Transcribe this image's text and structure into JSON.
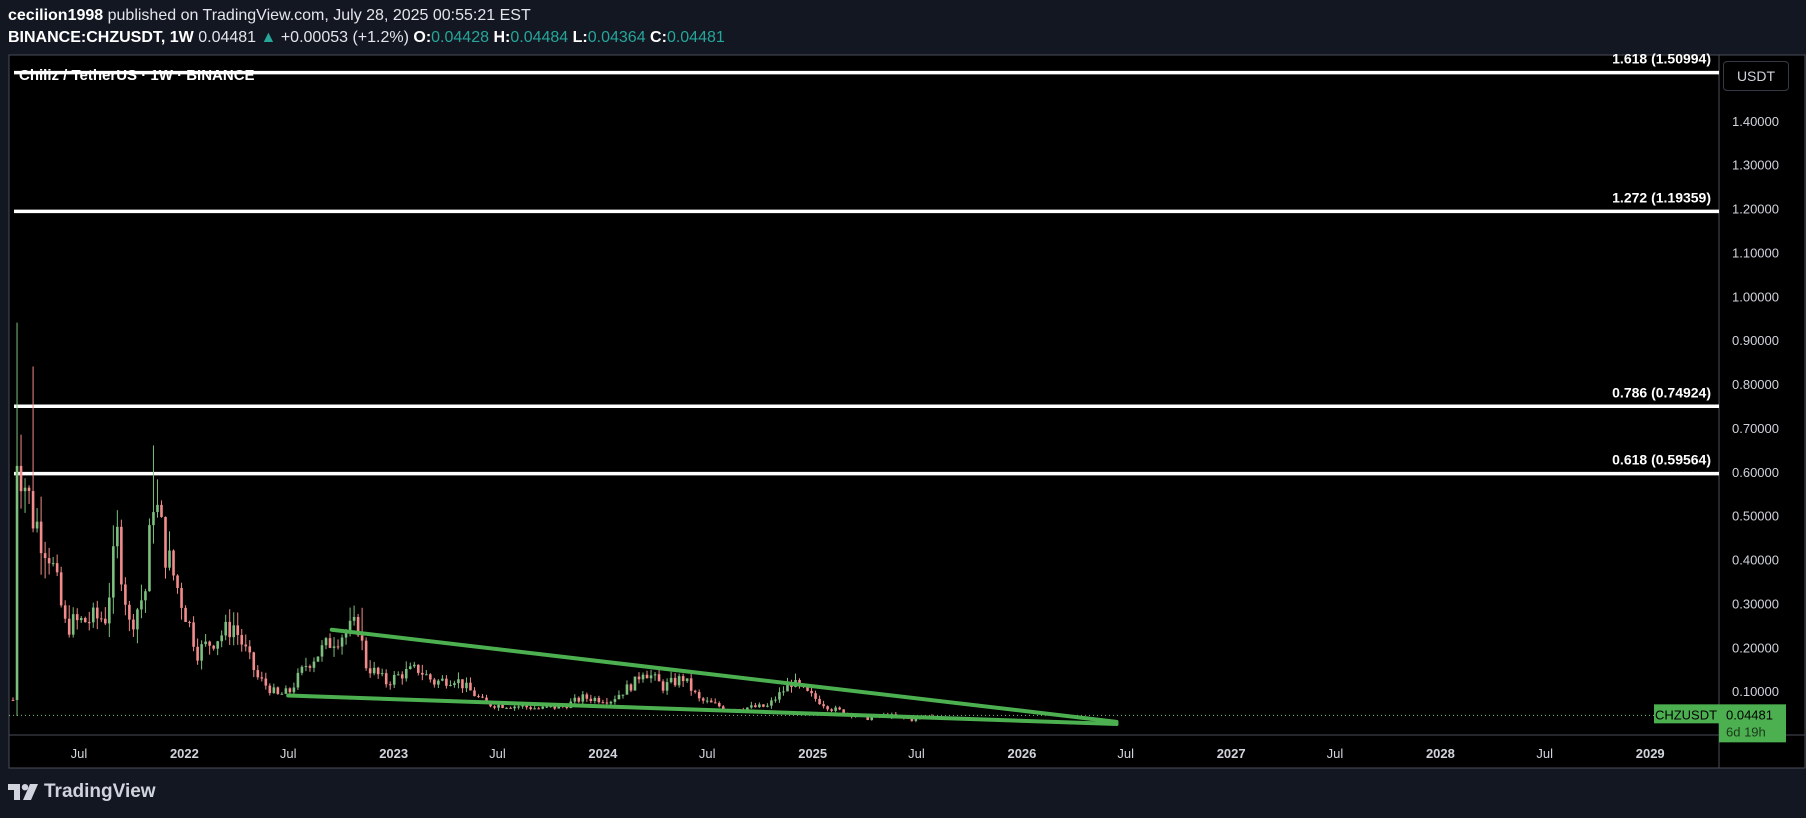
{
  "header": {
    "author": "cecilion1998",
    "published_text": "published on TradingView.com, July 28, 2025 00:55:21 EST",
    "symbol": "BINANCE:CHZUSDT, 1W",
    "last": "0.04481",
    "change_arrow": "▲",
    "change": "+0.00053 (+1.2%)",
    "o_label": "O:",
    "o": "0.04428",
    "h_label": "H:",
    "h": "0.04484",
    "l_label": "L:",
    "l": "0.04364",
    "c_label": "C:",
    "c": "0.04481"
  },
  "legend_title": "Chiliz / TetherUS · 1W · BINANCE",
  "currency_button": "USDT",
  "footer": {
    "brand": "TradingView",
    "logo_icon": "tradingview-logo-icon"
  },
  "colors": {
    "background": "#000000",
    "page": "#131722",
    "up": "#26a69a",
    "up_candle": "#7cbf7e",
    "down_candle": "#f28b8b",
    "trendline": "#4caf50",
    "fib_line": "#ffffff",
    "price_label_bg": "#4caf50"
  },
  "chart_data": {
    "type": "candlestick",
    "symbol": "CHZUSDT",
    "interval": "1W",
    "y_axis": {
      "min": 0.0,
      "max": 1.55,
      "ticks": [
        "0.10000",
        "0.20000",
        "0.30000",
        "0.40000",
        "0.50000",
        "0.60000",
        "0.70000",
        "0.80000",
        "0.90000",
        "1.00000",
        "1.10000",
        "1.20000",
        "1.30000",
        "1.40000"
      ]
    },
    "x_axis": {
      "start": "2021-03-01",
      "end": "2029-05-01",
      "ticks": [
        {
          "label": "Jul",
          "date": "2021-07-01"
        },
        {
          "label": "2022",
          "date": "2022-01-01"
        },
        {
          "label": "Jul",
          "date": "2022-07-01"
        },
        {
          "label": "2023",
          "date": "2023-01-01"
        },
        {
          "label": "Jul",
          "date": "2023-07-01"
        },
        {
          "label": "2024",
          "date": "2024-01-01"
        },
        {
          "label": "Jul",
          "date": "2024-07-01"
        },
        {
          "label": "2025",
          "date": "2025-01-01"
        },
        {
          "label": "Jul",
          "date": "2025-07-01"
        },
        {
          "label": "2026",
          "date": "2026-01-01"
        },
        {
          "label": "Jul",
          "date": "2026-07-01"
        },
        {
          "label": "2027",
          "date": "2027-01-01"
        },
        {
          "label": "Jul",
          "date": "2027-07-01"
        },
        {
          "label": "2028",
          "date": "2028-01-01"
        },
        {
          "label": "Jul",
          "date": "2028-07-01"
        },
        {
          "label": "2029",
          "date": "2029-01-01"
        }
      ]
    },
    "fib_levels": [
      {
        "label": "1.618 (1.50994)",
        "value": 1.50994
      },
      {
        "label": "1.272 (1.19359)",
        "value": 1.19359
      },
      {
        "label": "0.786 (0.74924)",
        "value": 0.74924
      },
      {
        "label": "0.618 (0.59564)",
        "value": 0.59564
      }
    ],
    "trendlines": [
      {
        "name": "upper",
        "from": {
          "date": "2022-09-15",
          "value": 0.24
        },
        "to": {
          "date": "2026-06-15",
          "value": 0.03
        }
      },
      {
        "name": "lower",
        "from": {
          "date": "2022-07-01",
          "value": 0.09
        },
        "to": {
          "date": "2026-06-15",
          "value": 0.025
        }
      }
    ],
    "price_anchors": [
      {
        "date": "2021-03-08",
        "value": 0.08
      },
      {
        "date": "2021-03-15",
        "value": 0.65
      },
      {
        "date": "2021-04-12",
        "value": 0.5
      },
      {
        "date": "2021-05-10",
        "value": 0.42
      },
      {
        "date": "2021-06-07",
        "value": 0.25
      },
      {
        "date": "2021-07-12",
        "value": 0.26
      },
      {
        "date": "2021-08-16",
        "value": 0.27
      },
      {
        "date": "2021-09-06",
        "value": 0.45
      },
      {
        "date": "2021-09-27",
        "value": 0.25
      },
      {
        "date": "2021-10-25",
        "value": 0.33
      },
      {
        "date": "2021-11-08",
        "value": 0.55
      },
      {
        "date": "2021-11-29",
        "value": 0.42
      },
      {
        "date": "2022-01-03",
        "value": 0.28
      },
      {
        "date": "2022-01-24",
        "value": 0.19
      },
      {
        "date": "2022-03-28",
        "value": 0.25
      },
      {
        "date": "2022-05-09",
        "value": 0.13
      },
      {
        "date": "2022-06-13",
        "value": 0.09
      },
      {
        "date": "2022-07-04",
        "value": 0.1
      },
      {
        "date": "2022-08-01",
        "value": 0.16
      },
      {
        "date": "2022-09-19",
        "value": 0.22
      },
      {
        "date": "2022-10-31",
        "value": 0.25
      },
      {
        "date": "2022-11-14",
        "value": 0.16
      },
      {
        "date": "2022-12-19",
        "value": 0.12
      },
      {
        "date": "2023-01-16",
        "value": 0.14
      },
      {
        "date": "2023-02-13",
        "value": 0.15
      },
      {
        "date": "2023-03-13",
        "value": 0.12
      },
      {
        "date": "2023-04-17",
        "value": 0.13
      },
      {
        "date": "2023-06-12",
        "value": 0.07
      },
      {
        "date": "2023-08-14",
        "value": 0.065
      },
      {
        "date": "2023-09-11",
        "value": 0.06
      },
      {
        "date": "2023-10-23",
        "value": 0.065
      },
      {
        "date": "2023-11-27",
        "value": 0.085
      },
      {
        "date": "2024-01-15",
        "value": 0.08
      },
      {
        "date": "2024-02-26",
        "value": 0.12
      },
      {
        "date": "2024-03-11",
        "value": 0.15
      },
      {
        "date": "2024-04-15",
        "value": 0.11
      },
      {
        "date": "2024-05-20",
        "value": 0.13
      },
      {
        "date": "2024-06-17",
        "value": 0.08
      },
      {
        "date": "2024-08-05",
        "value": 0.06
      },
      {
        "date": "2024-10-14",
        "value": 0.065
      },
      {
        "date": "2024-11-25",
        "value": 0.12
      },
      {
        "date": "2024-12-16",
        "value": 0.1
      },
      {
        "date": "2025-02-03",
        "value": 0.06
      },
      {
        "date": "2025-04-07",
        "value": 0.038
      },
      {
        "date": "2025-05-12",
        "value": 0.045
      },
      {
        "date": "2025-06-23",
        "value": 0.035
      },
      {
        "date": "2025-07-28",
        "value": 0.04481
      }
    ],
    "spikes": [
      {
        "date": "2021-03-15",
        "high": 0.94
      },
      {
        "date": "2021-04-12",
        "high": 0.84
      },
      {
        "date": "2021-11-08",
        "high": 0.66
      },
      {
        "date": "2022-11-07",
        "high": 0.29
      },
      {
        "date": "2024-12-02",
        "high": 0.14
      }
    ],
    "last_price": {
      "symbol": "CHZUSDT",
      "value": "0.04481",
      "countdown": "6d 19h",
      "numeric": 0.04481
    }
  }
}
